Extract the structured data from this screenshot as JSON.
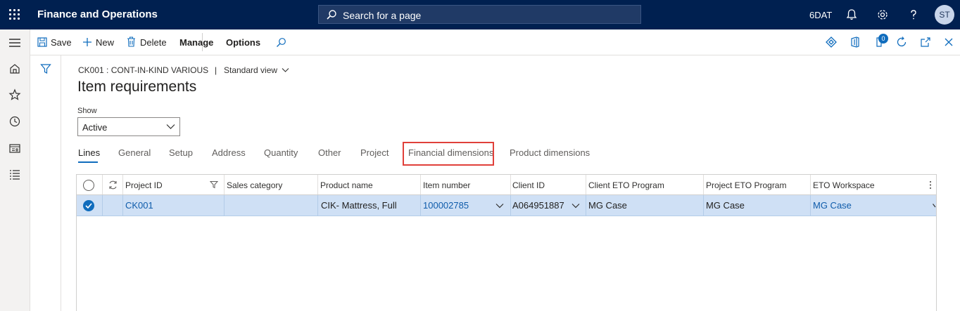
{
  "app": {
    "title": "Finance and Operations",
    "company": "6DAT",
    "user_initials": "ST"
  },
  "search": {
    "placeholder": "Search for a page"
  },
  "actions": {
    "save": "Save",
    "new": "New",
    "delete": "Delete",
    "manage": "Manage",
    "options": "Options",
    "notification_count": "0"
  },
  "page": {
    "caption": "CK001 : CONT-IN-KIND VARIOUS",
    "separator": "|",
    "view": "Standard view",
    "title": "Item requirements",
    "show_label": "Show",
    "show_value": "Active"
  },
  "tabs": [
    "Lines",
    "General",
    "Setup",
    "Address",
    "Quantity",
    "Other",
    "Project",
    "Financial dimensions",
    "Product dimensions"
  ],
  "grid": {
    "columns": [
      "Project ID",
      "Sales category",
      "Product name",
      "Item number",
      "Client ID",
      "Client ETO Program",
      "Project ETO Program",
      "ETO Workspace"
    ],
    "rows": [
      {
        "project_id": "CK001",
        "sales_category": "",
        "product_name": "CIK- Mattress, Full",
        "item_number": "100002785",
        "client_id": "A064951887",
        "client_eto_program": "MG Case",
        "project_eto_program": "MG Case",
        "eto_workspace": "MG Case"
      }
    ]
  },
  "colors": {
    "topbar": "#002050",
    "accent": "#0f6cbd",
    "selected_row": "#cfe0f5",
    "highlight": "#e0403a"
  }
}
